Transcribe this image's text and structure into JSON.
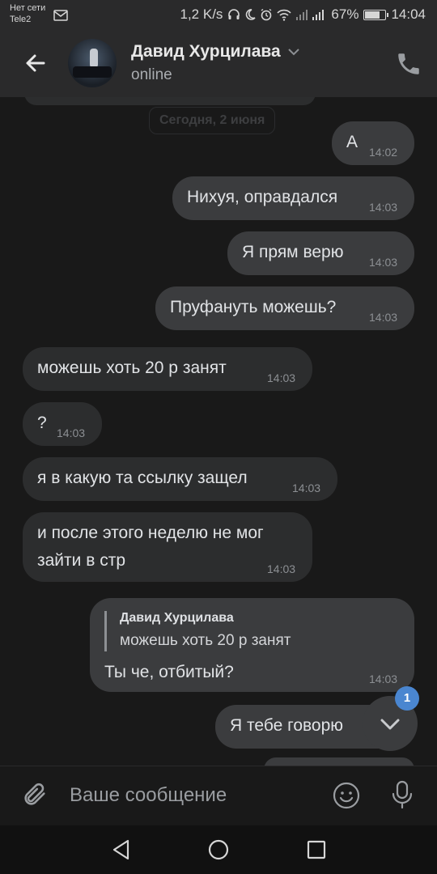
{
  "status_bar": {
    "carrier_line1": "Нет сети",
    "carrier_line2": "Tele2",
    "speed": "1,2 K/s",
    "battery": "67%",
    "battery_level": 0.67,
    "time": "14:04"
  },
  "header": {
    "contact_name": "Давид Хурцилава",
    "status": "online"
  },
  "chat": {
    "date_separator": "Сегодня, 2 июня",
    "messages": [
      {
        "direction": "out",
        "text": "А",
        "time": "14:02"
      },
      {
        "direction": "out",
        "text": "Нихуя, оправдался",
        "time": "14:03"
      },
      {
        "direction": "out",
        "text": "Я прям верю",
        "time": "14:03"
      },
      {
        "direction": "out",
        "text": "Пруфануть можешь?",
        "time": "14:03"
      },
      {
        "direction": "in",
        "text": "можешь хоть 20 р занят",
        "time": "14:03"
      },
      {
        "direction": "in",
        "text": "?",
        "time": "14:03"
      },
      {
        "direction": "in",
        "text": "я в какую та ссылку защел",
        "time": "14:03"
      },
      {
        "direction": "in",
        "text_line1": "и после этого неделю не мог",
        "text_line2": "зайти в стр",
        "time": "14:03"
      },
      {
        "direction": "out",
        "reply_author": "Давид Хурцилава",
        "reply_text": "можешь хоть 20 р занят",
        "text": "Ты че, отбитый?",
        "time": "14:03"
      },
      {
        "direction": "out",
        "text": "Я тебе говорю",
        "time": ""
      }
    ],
    "unread_badge": "1"
  },
  "composer": {
    "placeholder": "Ваше сообщение"
  },
  "icons": {
    "back": "arrow-left-icon",
    "call": "phone-icon",
    "attach": "paperclip-icon",
    "emoji": "smile-icon",
    "voice": "microphone-icon",
    "scroll_down": "chevron-down-icon"
  },
  "colors": {
    "background": "#191919",
    "bar": "#2a2a2b",
    "bubble_in": "#2c2d2e",
    "bubble_out": "#3b3c3e",
    "badge": "#4a86d0"
  }
}
